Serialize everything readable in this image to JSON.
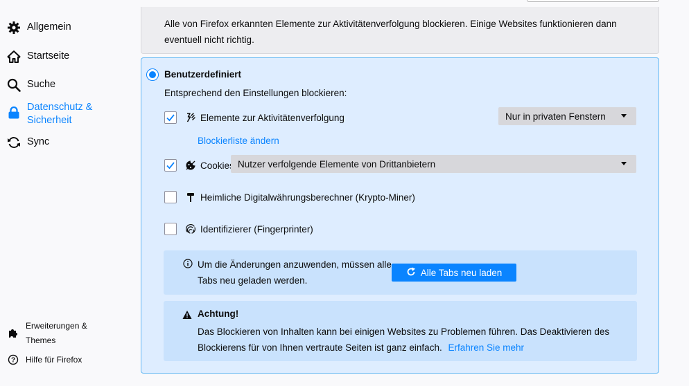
{
  "sidebar": {
    "items": [
      {
        "label": "Allgemein",
        "icon": "gear-icon"
      },
      {
        "label": "Startseite",
        "icon": "home-icon"
      },
      {
        "label": "Suche",
        "icon": "search-icon"
      },
      {
        "label_line1": "Datenschutz &",
        "label_line2": "Sicherheit",
        "icon": "lock-icon",
        "active": true
      },
      {
        "label": "Sync",
        "icon": "sync-icon"
      }
    ],
    "footer": {
      "extensions_line1": "Erweiterungen &",
      "extensions_line2": "Themes",
      "help": "Hilfe für Firefox"
    }
  },
  "strict": {
    "description": "Alle von Firefox erkannten Elemente zur Aktivitätenverfolgung blockieren. Einige Websites funktionieren dann eventuell nicht richtig."
  },
  "custom": {
    "title": "Benutzerdefiniert",
    "description": "Entsprechend den Einstellungen blockieren:",
    "trackers": {
      "label": "Elemente zur Aktivitätenverfolgung",
      "checked": true,
      "select_value": "Nur in privaten Fenstern"
    },
    "blocklist_link": "Blockierliste ändern",
    "cookies": {
      "label": "Cookies",
      "checked": true,
      "select_value": "Nutzer verfolgende Elemente von Drittanbietern"
    },
    "cryptominers": {
      "label": "Heimliche Digitalwährungsberechner (Krypto-Miner)",
      "checked": false
    },
    "fingerprinters": {
      "label": "Identifizierer (Fingerprinter)",
      "checked": false
    },
    "reload_info": "Um die Änderungen anzuwenden, müssen alle Tabs neu geladen werden.",
    "reload_button": "Alle Tabs neu laden",
    "warning_title": "Achtung!",
    "warning_text": "Das Blockieren von Inhalten kann bei einigen Websites zu Problemen führen. Das Deaktivieren des Blockierens für von Ihnen vertraute Seiten ist ganz einfach.",
    "learn_more": "Erfahren Sie mehr"
  },
  "colors": {
    "accent": "#0a84ff",
    "custom_bg": "#deedff",
    "custom_border": "#60b7f3",
    "info_bg": "#c9e2fd"
  }
}
